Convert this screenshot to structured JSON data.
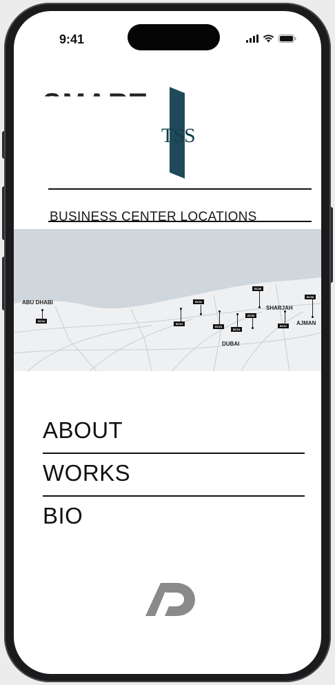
{
  "status_bar": {
    "time": "9:41"
  },
  "hero": {
    "partial_heading": "SMART",
    "logo_text": "TSS",
    "section_title": "BUSINESS CENTER LOCATIONS"
  },
  "map": {
    "cities": {
      "abu_dhabi": "ABU DHABI",
      "dubai": "DUBAI",
      "sharjah": "SHARJAH",
      "ajman": "AJMAN"
    },
    "tags": {
      "bc10": "BC10",
      "bc01": "BC01",
      "bc02": "BC02",
      "bc03": "BC03",
      "bc04": "BC04",
      "bc05": "BC05",
      "bc06": "BC06",
      "bc07": "BC07",
      "bc08": "BC08"
    }
  },
  "nav": {
    "items": [
      {
        "label": "ABOUT"
      },
      {
        "label": "WORKS"
      },
      {
        "label": "BIO"
      }
    ]
  },
  "colors": {
    "logo_teal": "#1f4a5a",
    "map_water": "#cfd6dc",
    "map_land": "#eef0f2",
    "brand_grey": "#8a8a8a"
  }
}
